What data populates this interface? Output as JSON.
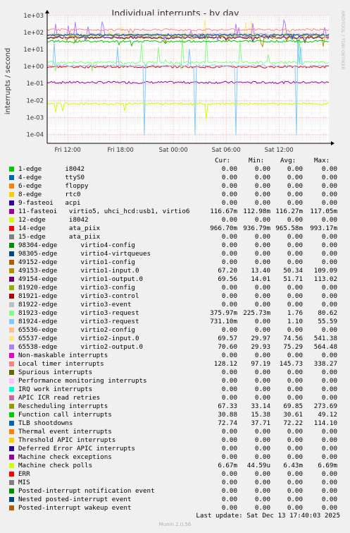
{
  "chart_data": {
    "type": "line",
    "title": "Individual interrupts - by day",
    "ylabel": "interrupts / second",
    "y_scale": "log",
    "ylim": [
      3e-05,
      1000
    ],
    "y_ticks": [
      "1e+03",
      "1e+02",
      "1e+01",
      "1e+00",
      "1e-01",
      "1e-02",
      "1e-03",
      "1e-04"
    ],
    "x_ticks": [
      "Fri 12:00",
      "Fri 18:00",
      "Sat 00:00",
      "Sat 06:00",
      "Sat 12:00"
    ],
    "x_range_hours": [
      "Fri 09:40",
      "Sat 17:40"
    ],
    "grid": true,
    "watermark": "RRDTOOL / TOBI OETIKER",
    "series_columns": [
      "Cur:",
      "Min:",
      "Avg:",
      "Max:"
    ],
    "series": [
      {
        "name": "1-edge      i8042",
        "color": "#00cc00",
        "cur": "0.00",
        "min": "0.00",
        "avg": "0.00",
        "max": "0.00"
      },
      {
        "name": "4-edge      ttyS0",
        "color": "#0066b3",
        "cur": "0.00",
        "min": "0.00",
        "avg": "0.00",
        "max": "0.00"
      },
      {
        "name": "6-edge      floppy",
        "color": "#ff8000",
        "cur": "0.00",
        "min": "0.00",
        "avg": "0.00",
        "max": "0.00"
      },
      {
        "name": "8-edge      rtc0",
        "color": "#ffcc00",
        "cur": "0.00",
        "min": "0.00",
        "avg": "0.00",
        "max": "0.00"
      },
      {
        "name": "9-fasteoi   acpi",
        "color": "#330099",
        "cur": "0.00",
        "min": "0.00",
        "avg": "0.00",
        "max": "0.00"
      },
      {
        "name": "11-fasteoi   virtio5, uhci_hcd:usb1, virtio6",
        "color": "#990099",
        "cur": "116.67m",
        "min": "112.98m",
        "avg": "116.27m",
        "max": "117.05m"
      },
      {
        "name": "12-edge      i8042",
        "color": "#ccff00",
        "cur": "0.00",
        "min": "0.00",
        "avg": "0.00",
        "max": "0.00"
      },
      {
        "name": "14-edge      ata_piix",
        "color": "#ff0000",
        "cur": "966.70m",
        "min": "936.79m",
        "avg": "965.58m",
        "max": "993.17m"
      },
      {
        "name": "15-edge      ata_piix",
        "color": "#808080",
        "cur": "0.00",
        "min": "0.00",
        "avg": "0.00",
        "max": "0.00"
      },
      {
        "name": "98304-edge      virtio4-config",
        "color": "#008f00",
        "cur": "0.00",
        "min": "0.00",
        "avg": "0.00",
        "max": "0.00"
      },
      {
        "name": "98305-edge      virtio4-virtqueues",
        "color": "#00487d",
        "cur": "0.00",
        "min": "0.00",
        "avg": "0.00",
        "max": "0.00"
      },
      {
        "name": "49152-edge      virtio1-config",
        "color": "#b35a00",
        "cur": "0.00",
        "min": "0.00",
        "avg": "0.00",
        "max": "0.00"
      },
      {
        "name": "49153-edge      virtio1-input.0",
        "color": "#b38f00",
        "cur": "67.20",
        "min": "13.40",
        "avg": "50.34",
        "max": "109.09"
      },
      {
        "name": "49154-edge      virtio1-output.0",
        "color": "#6b006b",
        "cur": "69.56",
        "min": "14.01",
        "avg": "51.71",
        "max": "113.02"
      },
      {
        "name": "81920-edge      virtio3-config",
        "color": "#8fb300",
        "cur": "0.00",
        "min": "0.00",
        "avg": "0.00",
        "max": "0.00"
      },
      {
        "name": "81921-edge      virtio3-control",
        "color": "#b30000",
        "cur": "0.00",
        "min": "0.00",
        "avg": "0.00",
        "max": "0.00"
      },
      {
        "name": "81922-edge      virtio3-event",
        "color": "#bebebe",
        "cur": "0.00",
        "min": "0.00",
        "avg": "0.00",
        "max": "0.00"
      },
      {
        "name": "81923-edge      virtio3-request",
        "color": "#80ff80",
        "cur": "375.97m",
        "min": "225.73m",
        "avg": "1.76",
        "max": "80.62"
      },
      {
        "name": "81924-edge      virtio3-request",
        "color": "#80c9ff",
        "cur": "731.10m",
        "min": "0.00",
        "avg": "1.10",
        "max": "55.59"
      },
      {
        "name": "65536-edge      virtio2-config",
        "color": "#ffc080",
        "cur": "0.00",
        "min": "0.00",
        "avg": "0.00",
        "max": "0.00"
      },
      {
        "name": "65537-edge      virtio2-input.0",
        "color": "#ffe680",
        "cur": "69.57",
        "min": "29.97",
        "avg": "74.56",
        "max": "541.38"
      },
      {
        "name": "65538-edge      virtio2-output.0",
        "color": "#aa80ff",
        "cur": "70.60",
        "min": "29.93",
        "avg": "75.29",
        "max": "564.48"
      },
      {
        "name": "Non-maskable interrupts",
        "color": "#ee00cc",
        "cur": "0.00",
        "min": "0.00",
        "avg": "0.00",
        "max": "0.00"
      },
      {
        "name": "Local timer interrupts",
        "color": "#ff8080",
        "cur": "128.12",
        "min": "97.19",
        "avg": "145.73",
        "max": "338.27"
      },
      {
        "name": "Spurious interrupts",
        "color": "#666600",
        "cur": "0.00",
        "min": "0.00",
        "avg": "0.00",
        "max": "0.00"
      },
      {
        "name": "Performance monitoring interrupts",
        "color": "#ffbfff",
        "cur": "0.00",
        "min": "0.00",
        "avg": "0.00",
        "max": "0.00"
      },
      {
        "name": "IRQ work interrupts",
        "color": "#00ffcc",
        "cur": "0.00",
        "min": "0.00",
        "avg": "0.00",
        "max": "0.00"
      },
      {
        "name": "APIC ICR read retries",
        "color": "#cc6699",
        "cur": "0.00",
        "min": "0.00",
        "avg": "0.00",
        "max": "0.00"
      },
      {
        "name": "Rescheduling interrupts",
        "color": "#999900",
        "cur": "67.33",
        "min": "33.14",
        "avg": "69.85",
        "max": "273.69"
      },
      {
        "name": "Function call interrupts",
        "color": "#00cc00",
        "cur": "30.88",
        "min": "15.38",
        "avg": "30.61",
        "max": "49.12"
      },
      {
        "name": "TLB shootdowns",
        "color": "#0066b3",
        "cur": "72.74",
        "min": "37.71",
        "avg": "72.22",
        "max": "114.10"
      },
      {
        "name": "Thermal event interrupts",
        "color": "#ff8000",
        "cur": "0.00",
        "min": "0.00",
        "avg": "0.00",
        "max": "0.00"
      },
      {
        "name": "Threshold APIC interrupts",
        "color": "#ffcc00",
        "cur": "0.00",
        "min": "0.00",
        "avg": "0.00",
        "max": "0.00"
      },
      {
        "name": "Deferred Error APIC interrupts",
        "color": "#330099",
        "cur": "0.00",
        "min": "0.00",
        "avg": "0.00",
        "max": "0.00"
      },
      {
        "name": "Machine check exceptions",
        "color": "#990099",
        "cur": "0.00",
        "min": "0.00",
        "avg": "0.00",
        "max": "0.00"
      },
      {
        "name": "Machine check polls",
        "color": "#ccff00",
        "cur": "6.67m",
        "min": "44.59u",
        "avg": "6.43m",
        "max": "6.69m"
      },
      {
        "name": "ERR",
        "color": "#ff0000",
        "cur": "0.00",
        "min": "0.00",
        "avg": "0.00",
        "max": "0.00"
      },
      {
        "name": "MIS",
        "color": "#808080",
        "cur": "0.00",
        "min": "0.00",
        "avg": "0.00",
        "max": "0.00"
      },
      {
        "name": "Posted-interrupt notification event",
        "color": "#008f00",
        "cur": "0.00",
        "min": "0.00",
        "avg": "0.00",
        "max": "0.00"
      },
      {
        "name": "Nested posted-interrupt event",
        "color": "#00487d",
        "cur": "0.00",
        "min": "0.00",
        "avg": "0.00",
        "max": "0.00"
      },
      {
        "name": "Posted-interrupt wakeup event",
        "color": "#b35a00",
        "cur": "0.00",
        "min": "0.00",
        "avg": "0.00",
        "max": "0.00"
      }
    ]
  },
  "footer": {
    "last_update": "Last update: Sat Dec 13 17:40:03 2025",
    "version": "Munin 2.0.56"
  }
}
